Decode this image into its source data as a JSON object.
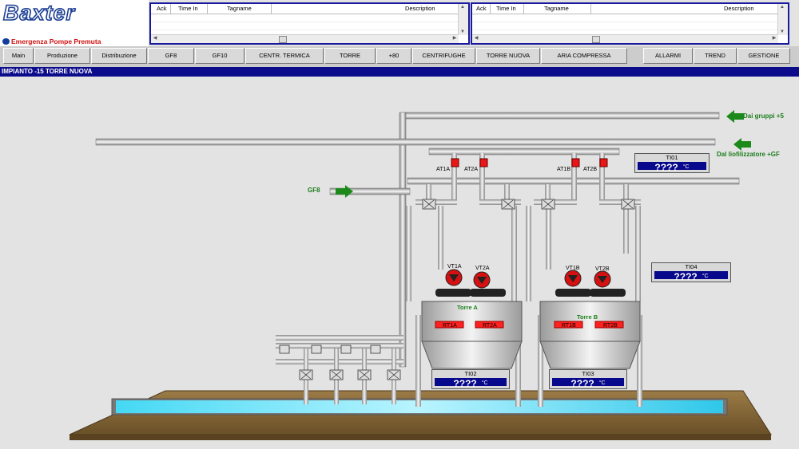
{
  "brand": {
    "logo": "Baxter",
    "emergency": "Emergenza Pompe Premuta"
  },
  "alarm_columns": [
    "Ack",
    "Time In",
    "Tagname",
    "Description"
  ],
  "nav": [
    "Main",
    "Produzione",
    "Distribuzione",
    "GF8",
    "GF10",
    "CENTR. TERMICA",
    "TORRE",
    "+80",
    "CENTRIFUGHE",
    "TORRE NUOVA",
    "ARIA COMPRESSA",
    "ALLARMI",
    "TREND",
    "GESTIONE"
  ],
  "page_title": "IMPIANTO -15 TORRE NUOVA",
  "inlets": {
    "gf8": "GF8",
    "gruppi": "Dai gruppi +5",
    "liofilizzatore": "Dal liofilizzatore +GF"
  },
  "towers": {
    "a": "Torre A",
    "b": "Torre B"
  },
  "valves": [
    "AT1A",
    "AT2A",
    "AT1B",
    "AT2B"
  ],
  "fans": [
    "VT1A",
    "VT2A",
    "VT1B",
    "VT2B"
  ],
  "heaters": [
    "RT1A",
    "RT2A",
    "RT1B",
    "RT2B"
  ],
  "temps": {
    "ti01": {
      "label": "TI01",
      "value": "????",
      "unit": "°C"
    },
    "ti02": {
      "label": "TI02",
      "value": "????",
      "unit": "°C"
    },
    "ti03": {
      "label": "TI03",
      "value": "????",
      "unit": "°C"
    },
    "ti04": {
      "label": "TI04",
      "value": "????",
      "unit": "°C"
    }
  },
  "colors": {
    "nav_title": "#0b0b8c",
    "value_box": "#08088c",
    "water": "#39d3f0",
    "arrow": "#1b8a1b",
    "valve_red": "#e81616"
  }
}
